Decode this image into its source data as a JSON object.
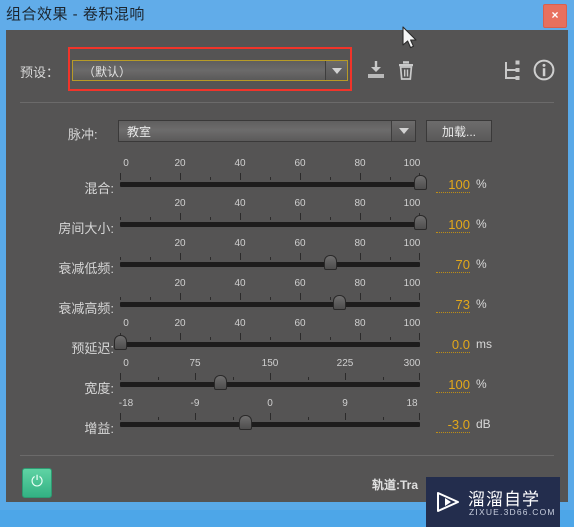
{
  "window": {
    "title": "组合效果 - 卷积混响",
    "close_label": "×",
    "accent_color": "#61ace9",
    "panel_color": "#555454"
  },
  "preset": {
    "label": "预设：",
    "value": "（默认）",
    "highlight_color": "#f1342a",
    "border_color": "#b79b27",
    "dropdown_icon": "chevron-down-icon",
    "tools": [
      {
        "name": "save-preset-icon",
        "title": "保存"
      },
      {
        "name": "delete-preset-icon",
        "title": "删除"
      },
      {
        "name": "routing-icon",
        "title": "路由"
      },
      {
        "name": "info-icon",
        "title": "信息"
      }
    ]
  },
  "impulse": {
    "label": "脉冲:",
    "value": "教室",
    "dropdown_icon": "chevron-down-icon",
    "load_button": "加载..."
  },
  "sliders": [
    {
      "label": "混合:",
      "value": "100",
      "unit": "%",
      "min": 0,
      "max": 100,
      "current": 100,
      "tick_labels": [
        "0",
        "20",
        "40",
        "60",
        "80",
        "100"
      ],
      "tick_values": [
        0,
        20,
        40,
        60,
        80,
        100
      ]
    },
    {
      "label": "房间大小:",
      "value": "100",
      "unit": "%",
      "min": 0,
      "max": 100,
      "current": 100,
      "tick_labels": [
        "20",
        "40",
        "60",
        "80",
        "100"
      ],
      "tick_values": [
        20,
        40,
        60,
        80,
        100
      ]
    },
    {
      "label": "衰减低频:",
      "value": "70",
      "unit": "%",
      "min": 0,
      "max": 100,
      "current": 70,
      "tick_labels": [
        "20",
        "40",
        "60",
        "80",
        "100"
      ],
      "tick_values": [
        20,
        40,
        60,
        80,
        100
      ]
    },
    {
      "label": "衰减高频:",
      "value": "73",
      "unit": "%",
      "min": 0,
      "max": 100,
      "current": 73,
      "tick_labels": [
        "20",
        "40",
        "60",
        "80",
        "100"
      ],
      "tick_values": [
        20,
        40,
        60,
        80,
        100
      ]
    },
    {
      "label": "预延迟:",
      "value": "0.0",
      "unit": "ms",
      "min": 0,
      "max": 100,
      "current": 0,
      "tick_labels": [
        "0",
        "20",
        "40",
        "60",
        "80",
        "100"
      ],
      "tick_values": [
        0,
        20,
        40,
        60,
        80,
        100
      ]
    },
    {
      "label": "宽度:",
      "value": "100",
      "unit": "%",
      "min": 0,
      "max": 300,
      "current": 100,
      "tick_labels": [
        "0",
        "75",
        "150",
        "225",
        "300"
      ],
      "tick_values": [
        0,
        75,
        150,
        225,
        300
      ]
    },
    {
      "label": "增益:",
      "value": "-3.0",
      "unit": "dB",
      "min": -18,
      "max": 18,
      "current": -3,
      "tick_labels": [
        "-18",
        "-9",
        "0",
        "9",
        "18"
      ],
      "tick_values": [
        -18,
        -9,
        0,
        9,
        18
      ]
    }
  ],
  "footer": {
    "power_icon": "power-icon",
    "power_state": "on",
    "power_color": "#33b183",
    "track_text": "轨道:Tra"
  },
  "watermark": {
    "title": "溜溜自学",
    "subtitle": "ZIXUE.3D66.COM",
    "icon": "play-icon",
    "background": "#232d4d"
  }
}
